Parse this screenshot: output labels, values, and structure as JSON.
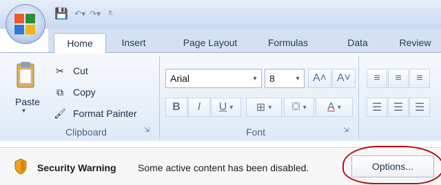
{
  "tabs": [
    {
      "label": "Home",
      "active": true
    },
    {
      "label": "Insert",
      "active": false
    },
    {
      "label": "Page Layout",
      "active": false
    },
    {
      "label": "Formulas",
      "active": false
    },
    {
      "label": "Data",
      "active": false
    },
    {
      "label": "Review",
      "active": false
    }
  ],
  "clipboard": {
    "paste_label": "Paste",
    "cut_label": "Cut",
    "copy_label": "Copy",
    "format_painter_label": "Format Painter",
    "group_title": "Clipboard"
  },
  "font": {
    "font_name": "Arial",
    "font_size": "8",
    "group_title": "Font"
  },
  "security_bar": {
    "title": "Security Warning",
    "message": "Some active content has been disabled.",
    "options_label": "Options..."
  },
  "colors": {
    "accent": "#c6d9f1",
    "callout": "#b30f15"
  }
}
